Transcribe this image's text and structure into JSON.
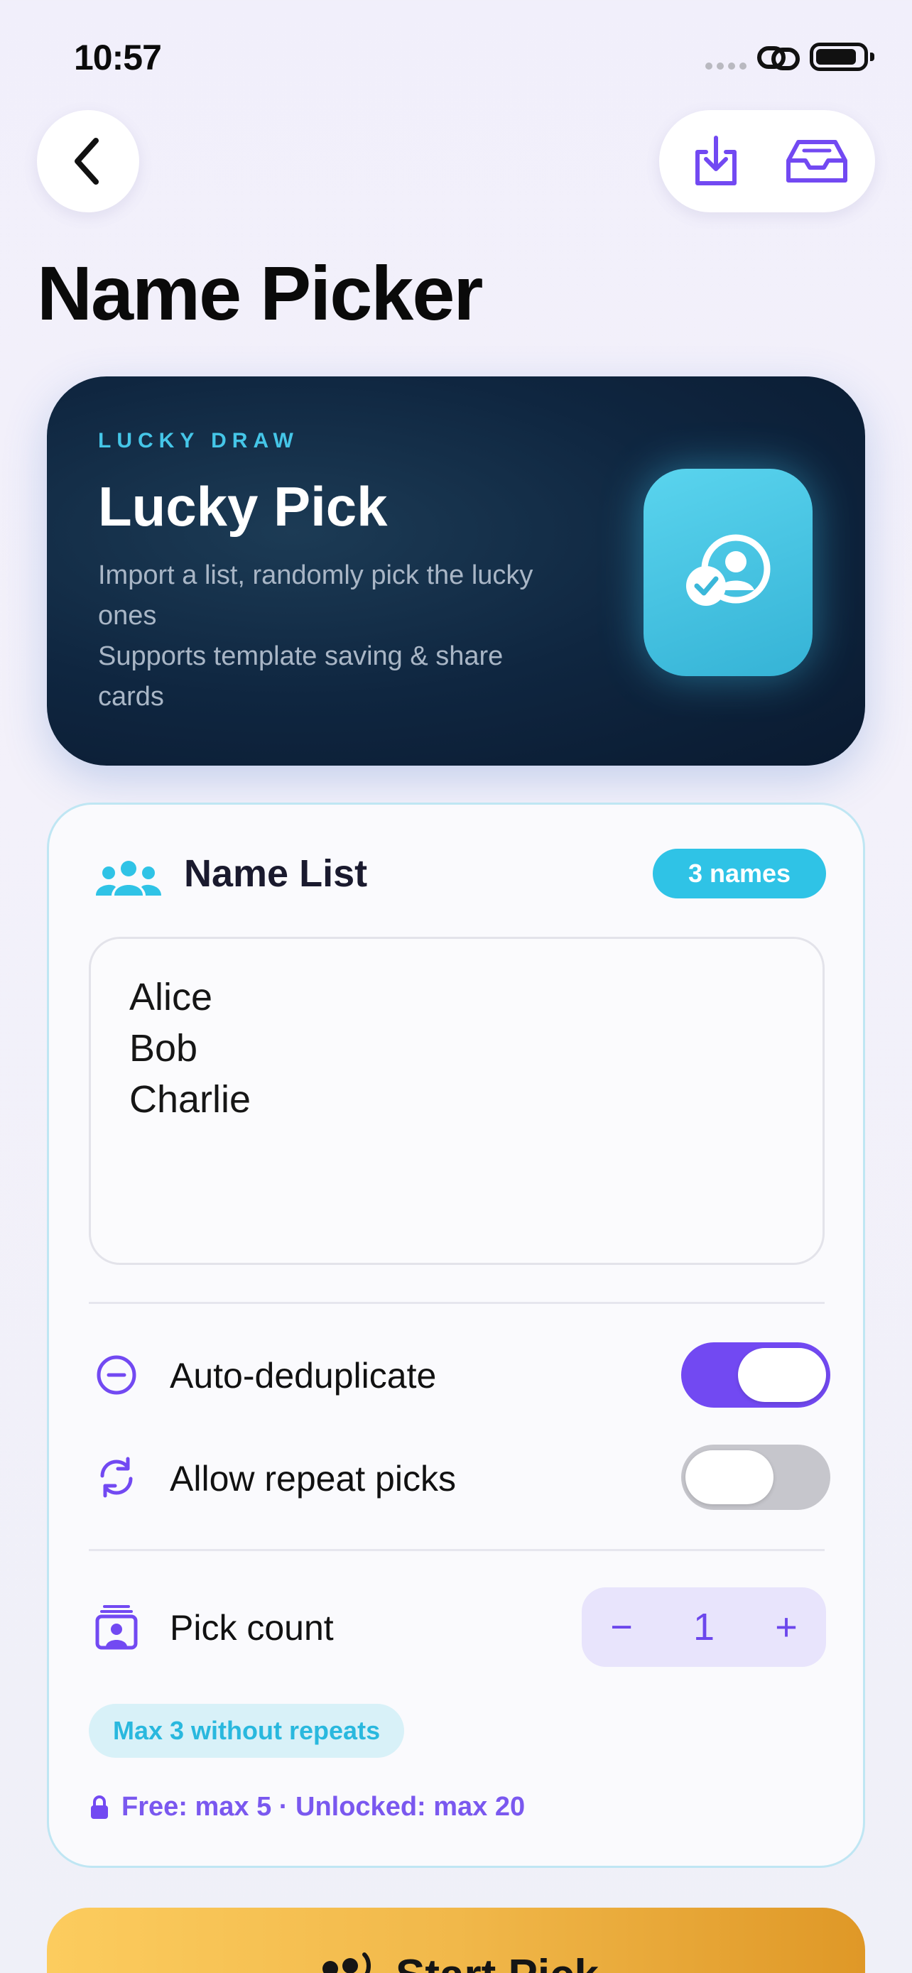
{
  "status_bar": {
    "time": "10:57"
  },
  "nav": {
    "title": "Name Picker"
  },
  "hero": {
    "eyebrow": "LUCKY DRAW",
    "title": "Lucky Pick",
    "description_line1": "Import a list, randomly pick the lucky ones",
    "description_line2": "Supports template saving & share cards"
  },
  "list": {
    "title": "Name List",
    "count_badge": "3 names",
    "names": [
      "Alice",
      "Bob",
      "Charlie"
    ]
  },
  "options": {
    "dedupe_label": "Auto-deduplicate",
    "dedupe_on": true,
    "repeat_label": "Allow repeat picks",
    "repeat_on": false
  },
  "pick": {
    "label": "Pick count",
    "minus": "−",
    "value": "1",
    "plus": "+",
    "limit_chip": "Max 3 without repeats",
    "plan_note": "Free: max 5 · Unlocked: max 20"
  },
  "actions": {
    "start_label": "Start Pick"
  },
  "colors": {
    "accent": "#7249f2",
    "cyan": "#2fc3e6",
    "start_button": "#f1b84a"
  }
}
